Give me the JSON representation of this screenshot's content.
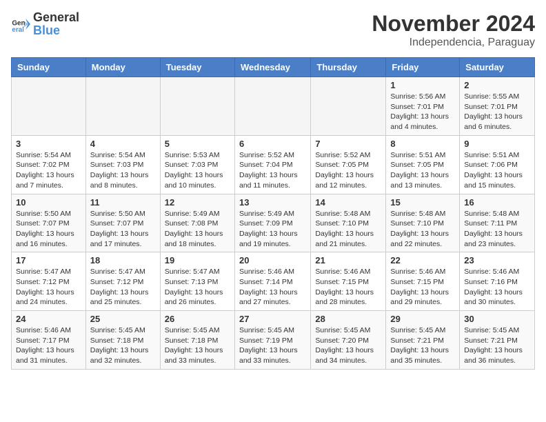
{
  "header": {
    "logo_general": "General",
    "logo_blue": "Blue",
    "month_title": "November 2024",
    "location": "Independencia, Paraguay"
  },
  "days_of_week": [
    "Sunday",
    "Monday",
    "Tuesday",
    "Wednesday",
    "Thursday",
    "Friday",
    "Saturday"
  ],
  "weeks": [
    [
      {
        "day": "",
        "info": ""
      },
      {
        "day": "",
        "info": ""
      },
      {
        "day": "",
        "info": ""
      },
      {
        "day": "",
        "info": ""
      },
      {
        "day": "",
        "info": ""
      },
      {
        "day": "1",
        "info": "Sunrise: 5:56 AM\nSunset: 7:01 PM\nDaylight: 13 hours\nand 4 minutes."
      },
      {
        "day": "2",
        "info": "Sunrise: 5:55 AM\nSunset: 7:01 PM\nDaylight: 13 hours\nand 6 minutes."
      }
    ],
    [
      {
        "day": "3",
        "info": "Sunrise: 5:54 AM\nSunset: 7:02 PM\nDaylight: 13 hours\nand 7 minutes."
      },
      {
        "day": "4",
        "info": "Sunrise: 5:54 AM\nSunset: 7:03 PM\nDaylight: 13 hours\nand 8 minutes."
      },
      {
        "day": "5",
        "info": "Sunrise: 5:53 AM\nSunset: 7:03 PM\nDaylight: 13 hours\nand 10 minutes."
      },
      {
        "day": "6",
        "info": "Sunrise: 5:52 AM\nSunset: 7:04 PM\nDaylight: 13 hours\nand 11 minutes."
      },
      {
        "day": "7",
        "info": "Sunrise: 5:52 AM\nSunset: 7:05 PM\nDaylight: 13 hours\nand 12 minutes."
      },
      {
        "day": "8",
        "info": "Sunrise: 5:51 AM\nSunset: 7:05 PM\nDaylight: 13 hours\nand 13 minutes."
      },
      {
        "day": "9",
        "info": "Sunrise: 5:51 AM\nSunset: 7:06 PM\nDaylight: 13 hours\nand 15 minutes."
      }
    ],
    [
      {
        "day": "10",
        "info": "Sunrise: 5:50 AM\nSunset: 7:07 PM\nDaylight: 13 hours\nand 16 minutes."
      },
      {
        "day": "11",
        "info": "Sunrise: 5:50 AM\nSunset: 7:07 PM\nDaylight: 13 hours\nand 17 minutes."
      },
      {
        "day": "12",
        "info": "Sunrise: 5:49 AM\nSunset: 7:08 PM\nDaylight: 13 hours\nand 18 minutes."
      },
      {
        "day": "13",
        "info": "Sunrise: 5:49 AM\nSunset: 7:09 PM\nDaylight: 13 hours\nand 19 minutes."
      },
      {
        "day": "14",
        "info": "Sunrise: 5:48 AM\nSunset: 7:10 PM\nDaylight: 13 hours\nand 21 minutes."
      },
      {
        "day": "15",
        "info": "Sunrise: 5:48 AM\nSunset: 7:10 PM\nDaylight: 13 hours\nand 22 minutes."
      },
      {
        "day": "16",
        "info": "Sunrise: 5:48 AM\nSunset: 7:11 PM\nDaylight: 13 hours\nand 23 minutes."
      }
    ],
    [
      {
        "day": "17",
        "info": "Sunrise: 5:47 AM\nSunset: 7:12 PM\nDaylight: 13 hours\nand 24 minutes."
      },
      {
        "day": "18",
        "info": "Sunrise: 5:47 AM\nSunset: 7:12 PM\nDaylight: 13 hours\nand 25 minutes."
      },
      {
        "day": "19",
        "info": "Sunrise: 5:47 AM\nSunset: 7:13 PM\nDaylight: 13 hours\nand 26 minutes."
      },
      {
        "day": "20",
        "info": "Sunrise: 5:46 AM\nSunset: 7:14 PM\nDaylight: 13 hours\nand 27 minutes."
      },
      {
        "day": "21",
        "info": "Sunrise: 5:46 AM\nSunset: 7:15 PM\nDaylight: 13 hours\nand 28 minutes."
      },
      {
        "day": "22",
        "info": "Sunrise: 5:46 AM\nSunset: 7:15 PM\nDaylight: 13 hours\nand 29 minutes."
      },
      {
        "day": "23",
        "info": "Sunrise: 5:46 AM\nSunset: 7:16 PM\nDaylight: 13 hours\nand 30 minutes."
      }
    ],
    [
      {
        "day": "24",
        "info": "Sunrise: 5:46 AM\nSunset: 7:17 PM\nDaylight: 13 hours\nand 31 minutes."
      },
      {
        "day": "25",
        "info": "Sunrise: 5:45 AM\nSunset: 7:18 PM\nDaylight: 13 hours\nand 32 minutes."
      },
      {
        "day": "26",
        "info": "Sunrise: 5:45 AM\nSunset: 7:18 PM\nDaylight: 13 hours\nand 33 minutes."
      },
      {
        "day": "27",
        "info": "Sunrise: 5:45 AM\nSunset: 7:19 PM\nDaylight: 13 hours\nand 33 minutes."
      },
      {
        "day": "28",
        "info": "Sunrise: 5:45 AM\nSunset: 7:20 PM\nDaylight: 13 hours\nand 34 minutes."
      },
      {
        "day": "29",
        "info": "Sunrise: 5:45 AM\nSunset: 7:21 PM\nDaylight: 13 hours\nand 35 minutes."
      },
      {
        "day": "30",
        "info": "Sunrise: 5:45 AM\nSunset: 7:21 PM\nDaylight: 13 hours\nand 36 minutes."
      }
    ]
  ]
}
